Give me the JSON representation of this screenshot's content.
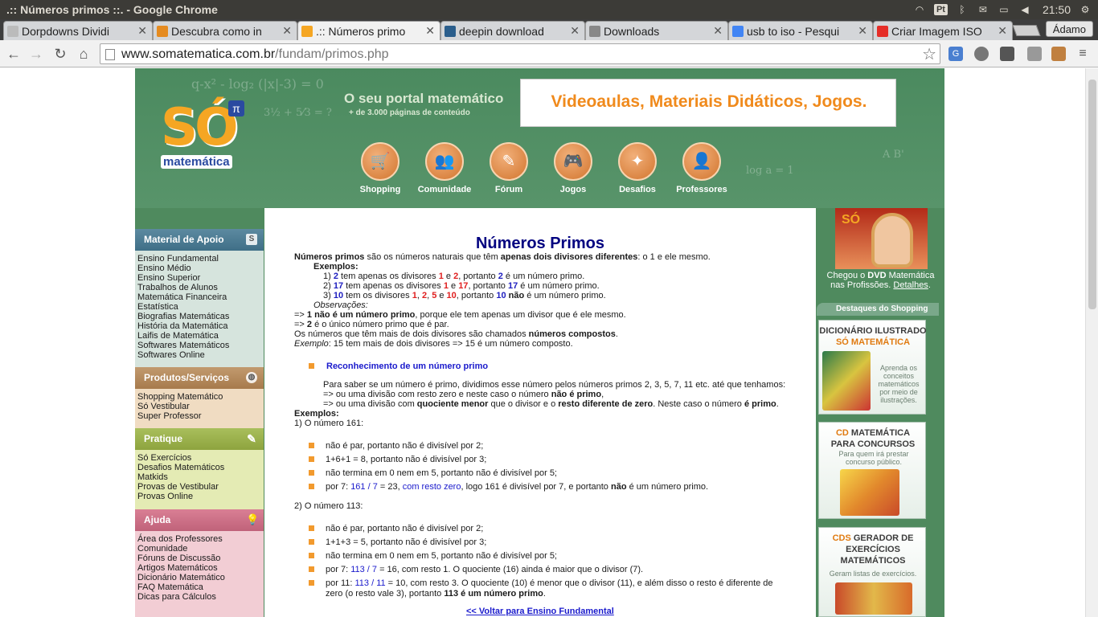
{
  "os": {
    "window_title": ".:: Números primos ::. - Google Chrome",
    "keyboard_layout": "Pt",
    "clock": "21:50"
  },
  "tabs": [
    {
      "label": "Dorpdowns Dividi"
    },
    {
      "label": "Descubra como in"
    },
    {
      "label": ".:: Números primo"
    },
    {
      "label": "deepin download"
    },
    {
      "label": "Downloads"
    },
    {
      "label": "usb to iso - Pesqui"
    },
    {
      "label": "Criar Imagem ISO"
    }
  ],
  "profile_name": "Ádamo",
  "address": {
    "domain": "www.somatematica.com.br",
    "path": "/fundam/primos.php"
  },
  "header": {
    "logo_text": "SÓ",
    "logo_pi": "π",
    "logo_word": "matemática",
    "tagline": "O seu portal matemático",
    "tagline_sub": "+ de 3.000 páginas de conteúdo",
    "banner": "Videoaulas, Materiais Didáticos, Jogos.",
    "nav": [
      "Shopping",
      "Comunidade",
      "Fórum",
      "Jogos",
      "Desafios",
      "Professores"
    ]
  },
  "sidebar": {
    "material": {
      "title": "Material de Apoio",
      "items": [
        "Ensino Fundamental",
        "Ensino Médio",
        "Ensino Superior",
        "Trabalhos de Alunos",
        "Matemática Financeira",
        "Estatística",
        "Biografias Matemáticas",
        "História da Matemática",
        "Laifis de Matemática",
        "Softwares Matemáticos",
        "Softwares Online"
      ]
    },
    "produtos": {
      "title": "Produtos/Serviços",
      "items": [
        "Shopping Matemático",
        "Só Vestibular",
        "Super Professor"
      ]
    },
    "pratique": {
      "title": "Pratique",
      "items": [
        "Só Exercícios",
        "Desafios Matemáticos",
        "Matkids",
        "Provas de Vestibular",
        "Provas Online"
      ]
    },
    "ajuda": {
      "title": "Ajuda",
      "items": [
        "Área dos Professores",
        "Comunidade",
        "Fóruns de Discussão",
        "Artigos Matemáticos",
        "Dicionário Matemático",
        "FAQ Matemática",
        "Dicas para Cálculos"
      ]
    }
  },
  "content": {
    "title": "Números Primos",
    "def_term": "Números primos",
    "def_mid": " são os números naturais que têm ",
    "def_bold": "apenas dois divisores diferentes",
    "def_end": ": o 1 e ele mesmo.",
    "exemplos_label": "Exemplos:",
    "ex1": {
      "pre": "1) ",
      "n": "2",
      "mid": " tem apenas os divisores ",
      "d1": "1",
      "e": " e ",
      "d2": "2",
      "mid2": ", portanto ",
      "n2": "2",
      "end": " é um número primo."
    },
    "ex2": {
      "pre": "2) ",
      "n": "17",
      "mid": " tem apenas os divisores ",
      "d1": "1",
      "e": " e ",
      "d2": "17",
      "mid2": ", portanto ",
      "n2": "17",
      "end": " é um número primo."
    },
    "ex3": {
      "pre": "3) ",
      "n": "10",
      "mid": " tem os divisores ",
      "d1": "1",
      "c1": ", ",
      "d2": "2",
      "c2": ", ",
      "d3": "5",
      "e": " e ",
      "d4": "10",
      "mid2": ", portanto ",
      "n2": "10",
      "nao": " não",
      "end": " é um número primo."
    },
    "obs_label": "Observações:",
    "obs1_pre": "=> ",
    "obs1_bold": "1 não é um número primo",
    "obs1_end": ", porque ele tem apenas um divisor que é ele mesmo.",
    "obs2_pre": "=> ",
    "obs2_bold": "2",
    "obs2_end": " é o único número primo que é par.",
    "compostos_pre": "Os números que têm mais de dois divisores são chamados ",
    "compostos_bold": "números compostos",
    "compostos_end": ".",
    "exemplo_it": "Exemplo",
    "exemplo_end": ": 15 tem mais de dois divisores => 15 é um número composto.",
    "section_title": "Reconhecimento de um número primo",
    "rec1": "Para saber se um número é primo, dividimos esse número pelos números primos 2, 3, 5, 7, 11 etc. até que tenhamos:",
    "rec2_pre": "=>  ou uma divisão com resto zero e neste caso o número ",
    "rec2_bold": "não é primo",
    "rec2_end": ",",
    "rec3_pre": "=>  ou uma divisão com ",
    "rec3_b1": "quociente menor",
    "rec3_mid": " que o divisor e o ",
    "rec3_b2": "resto diferente de zero",
    "rec3_mid2": ". Neste caso o número ",
    "rec3_b3": "é primo",
    "rec3_end": ".",
    "exemplos2_label": "Exemplos:",
    "n161_title": "1) O número 161:",
    "n161": [
      "não é par, portanto não é divisível por 2;",
      "1+6+1 = 8, portanto não é divisível por 3;",
      "não termina em 0 nem em 5, portanto não é divisível por 5;"
    ],
    "n161_last": {
      "pre": "por 7:  ",
      "link1": "161 / 7",
      "mid": " = 23, ",
      "link2": "com resto zero",
      "mid2": ", logo 161 é divisível por 7, e portanto ",
      "bold": "não",
      "end": " é um número primo."
    },
    "n113_title": "2) O número 113:",
    "n113": [
      "não é par, portanto não é divisível por 2;",
      "1+1+3 = 5, portanto não é divisível por 3;",
      "não termina em 0 nem em 5, portanto não é divisível por 5;"
    ],
    "n113_7": {
      "pre": "por 7:  ",
      "link": "113 / 7",
      "end": " = 16, com resto 1. O quociente (16) ainda é maior que o divisor (7)."
    },
    "n113_11": {
      "pre": "por 11:  ",
      "link": "113 / 11",
      "end": " = 10, com resto 3. O quociente (10) é menor que o divisor (11), e além disso o resto é diferente de",
      "line2_pre": "zero (o resto vale 3), portanto ",
      "line2_bold": "113 é um número primo",
      "line2_end": "."
    },
    "back_link": "<< Voltar para Ensino Fundamental"
  },
  "right": {
    "dvd_logo": "SÓ",
    "dvd_pre": "Chegou o ",
    "dvd_bold": "DVD",
    "dvd_mid": " Matemática",
    "dvd_line2": "nas Profissões. ",
    "dvd_link": "Detalhes",
    "dvd_end": ".",
    "shop_tag": "Destaques do Shopping",
    "card1_title1": "DICIONÁRIO ILUSTRADO",
    "card1_title2": "SÓ MATEMÁTICA",
    "card1_desc": "Aprenda os conceitos matemáticos por meio de ilustrações.",
    "card2_org": "CD",
    "card2_title1": " MATEMÁTICA",
    "card2_title2": "PARA CONCURSOS",
    "card2_desc": "Para quem irá prestar concurso público.",
    "card3_org": "CDS",
    "card3_title1": " GERADOR DE",
    "card3_title2": "EXERCÍCIOS",
    "card3_title3": "MATEMÁTICOS",
    "card3_desc": "Geram listas de exercícios."
  }
}
